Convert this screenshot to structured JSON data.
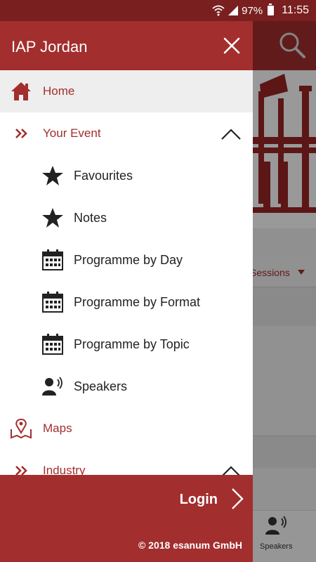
{
  "status_bar": {
    "battery": "97%",
    "time": "11:55"
  },
  "drawer": {
    "title": "IAP Jordan"
  },
  "menu": {
    "home": {
      "label": "Home",
      "icon": "home-icon"
    },
    "your_event": {
      "label": "Your Event",
      "icon": "double-chevron-icon"
    },
    "sub_items": [
      {
        "label": "Favourites",
        "icon": "star-icon"
      },
      {
        "label": "Notes",
        "icon": "star-icon"
      },
      {
        "label": "Programme by Day",
        "icon": "calendar-icon"
      },
      {
        "label": "Programme by Format",
        "icon": "calendar-icon"
      },
      {
        "label": "Programme by Topic",
        "icon": "calendar-icon"
      },
      {
        "label": "Speakers",
        "icon": "speaker-icon"
      }
    ],
    "maps": {
      "label": "Maps",
      "icon": "map-pin-icon"
    },
    "industry": {
      "label": "Industry",
      "icon": "double-chevron-icon"
    }
  },
  "footer": {
    "login": "Login",
    "copyright": "© 2018 esanum GmbH"
  },
  "background": {
    "sessions": "Sessions",
    "bottom_nav_speakers": "Speakers"
  },
  "colors": {
    "brand": "#a32e2e",
    "status_bar": "#7a1f1f",
    "active_row": "#eeeeee"
  }
}
